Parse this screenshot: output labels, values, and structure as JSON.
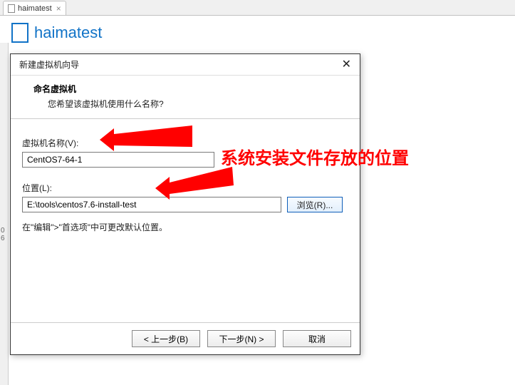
{
  "tab": {
    "label": "haimatest"
  },
  "header": {
    "title": "haimatest"
  },
  "gutter": {
    "marks": "0\n6"
  },
  "dialog": {
    "title": "新建虚拟机向导",
    "heading": "命名虚拟机",
    "subheading": "您希望该虚拟机使用什么名称?",
    "name_label": "虚拟机名称(V):",
    "name_value": "CentOS7-64-1",
    "location_label": "位置(L):",
    "location_value": "E:\\tools\\centos7.6-install-test",
    "browse_label": "浏览(R)...",
    "hint": "在\"编辑\">\"首选项\"中可更改默认位置。",
    "back_label": "< 上一步(B)",
    "next_label": "下一步(N) >",
    "cancel_label": "取消"
  },
  "annotation": {
    "text": "系统安装文件存放的位置"
  }
}
